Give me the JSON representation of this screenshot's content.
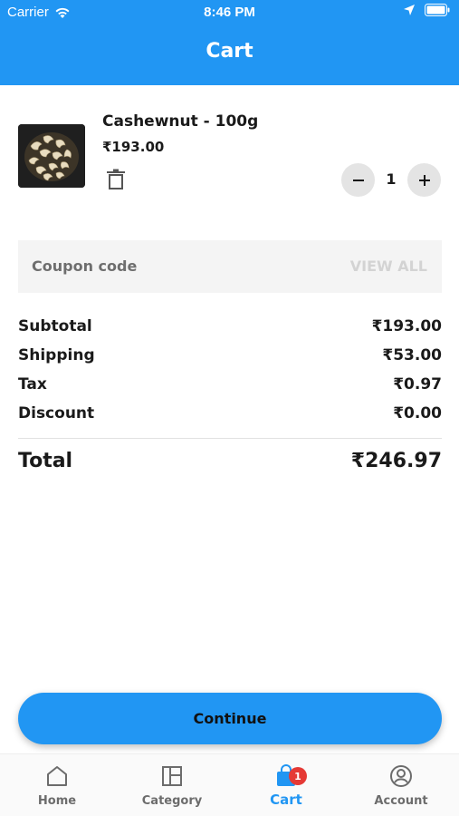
{
  "status_bar": {
    "carrier": "Carrier",
    "time": "8:46 PM"
  },
  "header": {
    "title": "Cart"
  },
  "cart_item": {
    "name": "Cashewnut - 100g",
    "price": "₹193.00",
    "quantity": "1"
  },
  "coupon": {
    "placeholder": "Coupon code",
    "view_all": "VIEW ALL"
  },
  "summary": {
    "subtotal_label": "Subtotal",
    "subtotal": "₹193.00",
    "shipping_label": "Shipping",
    "shipping": "₹53.00",
    "tax_label": "Tax",
    "tax": "₹0.97",
    "discount_label": "Discount",
    "discount": "₹0.00",
    "total_label": "Total",
    "total": "₹246.97"
  },
  "continue_label": "Continue",
  "tabs": [
    {
      "label": "Home",
      "icon": "home-icon"
    },
    {
      "label": "Category",
      "icon": "category-icon"
    },
    {
      "label": "Cart",
      "icon": "cart-icon",
      "badge": "1",
      "active": true
    },
    {
      "label": "Account",
      "icon": "account-icon"
    }
  ],
  "colors": {
    "primary": "#2196F3",
    "badge": "#E53935"
  }
}
